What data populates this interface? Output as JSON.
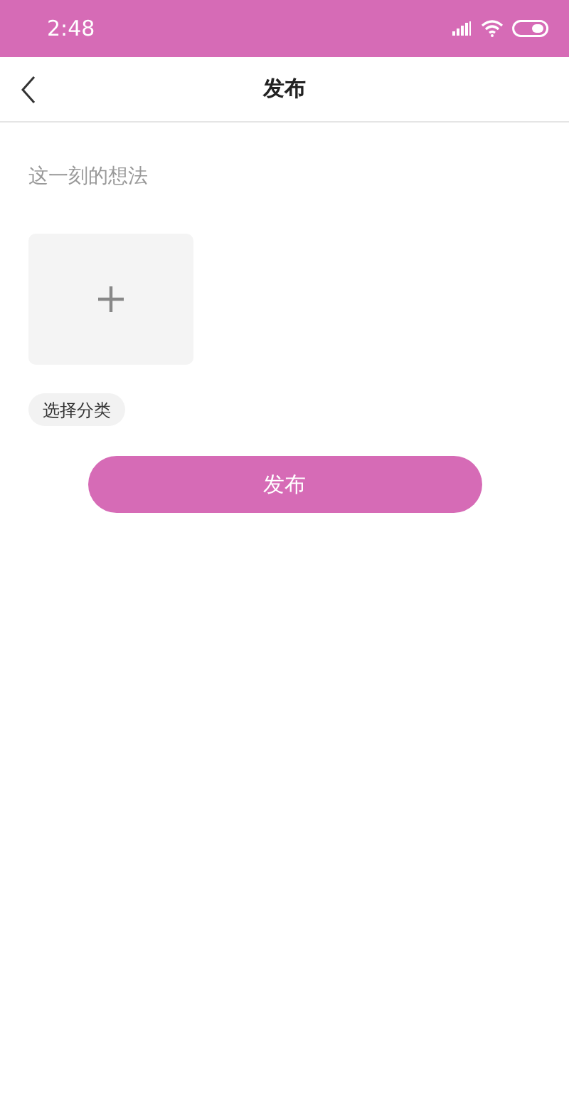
{
  "status_bar": {
    "time": "2:48"
  },
  "nav_bar": {
    "title": "发布"
  },
  "thought_field": {
    "placeholder": "这一刻的想法"
  },
  "category_chip": "选择分类",
  "publish_button": "发布"
}
